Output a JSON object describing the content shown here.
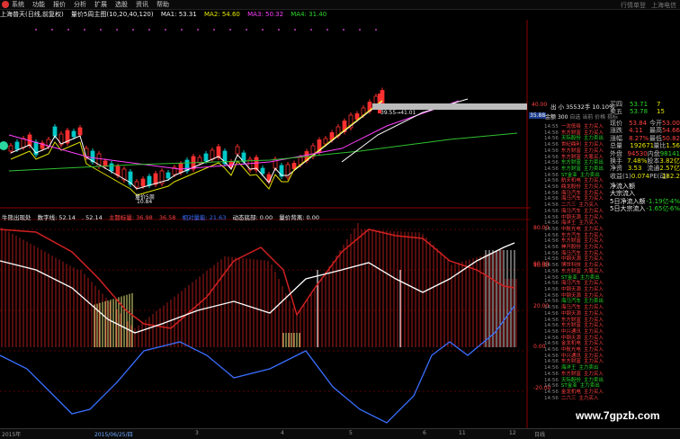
{
  "menu": {
    "items": [
      "系统",
      "功能",
      "报价",
      "分析",
      "扩展",
      "选股",
      "资讯",
      "帮助"
    ],
    "right": [
      "行情单登",
      "上海电信"
    ]
  },
  "chart_header": {
    "title": "上海普天(日线,前复权)",
    "indicator": "量价5周主图(10,20,40,120)",
    "ma1": "MA1: 53.31",
    "ma2": "MA2: 54.60",
    "ma3": "MA3: 50.32",
    "ma4": "MA4: 31.40"
  },
  "indicator_header": {
    "name": "牛熊出现处",
    "v1": "数字线: 52.14",
    "v2": ". 52.14",
    "v3": "主题标量: 36.98",
    "v4": "36.58",
    "v5": "相对量能: 21.63",
    "v6": "动态底部: 0.00",
    "v7": "量价背离: 0.00"
  },
  "price_labels": {
    "top": "40.00",
    "sell_tag": "出 小",
    "sell_vol": "35532手",
    "sell_pct": "10.10%",
    "price_line": "39.55→41.01",
    "left_price": "35.88",
    "low_label": "量价5周",
    "low_price": "10.84"
  },
  "axis_right": [
    "80.00",
    "60.00",
    "40.00",
    "20.00",
    "0.00",
    "-20.00"
  ],
  "quote": {
    "ask": {
      "label": "买四",
      "price": "53.71",
      "vol": "7"
    },
    "ask5": {
      "label": "卖五",
      "price": "53.78",
      "vol": "15"
    },
    "rows": [
      {
        "label": "现价",
        "value": "53.84",
        "l2": "今开",
        "v2": "53.00"
      },
      {
        "label": "涨跌",
        "value": "4.11",
        "l2": "最高",
        "v2": "54.66"
      },
      {
        "label": "涨幅",
        "value": "8.27%",
        "l2": "最低",
        "v2": "50.82"
      },
      {
        "label": "总量",
        "value": "192671",
        "l2": "量比",
        "v2": "1.56"
      },
      {
        "label": "外盘",
        "value": "94530",
        "l2": "内盘",
        "v2": "98141"
      },
      {
        "label": "换手",
        "value": "7.48%",
        "l2": "股本",
        "v2": "3.82亿"
      },
      {
        "label": "净资",
        "value": "3.53",
        "l2": "流通",
        "v2": "2.57亿"
      },
      {
        "label": "收益(1)",
        "value": "0.074",
        "l2": "PE(动)",
        "v2": "182.2"
      }
    ],
    "bid": {
      "label": "金额",
      "value": "300",
      "extra": "自选 当前 价格 指标"
    }
  },
  "funds": [
    {
      "label": "净流入额",
      "value": ""
    },
    {
      "label": "大宗流入",
      "value": ""
    },
    {
      "label": "5日净流入额",
      "value": "-1.19亿",
      "pct": "-4%"
    },
    {
      "label": "5日大宗流入",
      "value": "-1.65亿",
      "pct": "-6%"
    }
  ],
  "trades": [
    [
      "14:55",
      "一沈低吸",
      "主力买入"
    ],
    [
      "14:56",
      "东方财富",
      "主力买入"
    ],
    [
      "14:56",
      "天际股份",
      "主力卖出"
    ],
    [
      "14:56",
      "世纪鼎利",
      "主力买入"
    ],
    [
      "14:56",
      "东方财富",
      "主力买入"
    ],
    [
      "14:56",
      "东方财富",
      "大笔买入"
    ],
    [
      "14:56",
      "东方财富",
      "主力卖出"
    ],
    [
      "14:56",
      "东方财富",
      "主力卖出"
    ],
    [
      "14:56",
      "ST金亚",
      "主力卖出"
    ],
    [
      "14:56",
      "航天机电",
      "主力买入"
    ],
    [
      "14:56",
      "鼎龙股份",
      "主力买入"
    ],
    [
      "14:56",
      "海马汽车",
      "主力买入"
    ],
    [
      "14:56",
      "海马汽车",
      "主力买入"
    ],
    [
      "14:56",
      "二六三",
      "主力买入"
    ],
    [
      "14:56",
      "海马汽车",
      "主力买入"
    ],
    [
      "14:56",
      "中钢天源",
      "主力买入"
    ],
    [
      "14:56",
      "海洋王",
      "主力买入"
    ],
    [
      "14:56",
      "中航光电",
      "主力买入"
    ],
    [
      "14:56",
      "东方汽车",
      "主力买入"
    ],
    [
      "14:56",
      "东方财富",
      "主力买入"
    ],
    [
      "14:56",
      "神开股份",
      "主力买入"
    ],
    [
      "14:56",
      "海马汽车",
      "主力买入"
    ],
    [
      "14:56",
      "中钢天源",
      "主力买入"
    ],
    [
      "14:56",
      "博世科技",
      "主力买入"
    ],
    [
      "14:56",
      "东方财富",
      "大笔买入"
    ],
    [
      "14:56",
      "ST金亚",
      "主力卖出"
    ],
    [
      "14:56",
      "海马汽车",
      "主力买入"
    ],
    [
      "14:56",
      "中钢天源",
      "主力买入"
    ],
    [
      "14:56",
      "中钢天源",
      "主力买入"
    ],
    [
      "14:56",
      "海马汽车",
      "主力卖出"
    ],
    [
      "14:56",
      "海马汽车",
      "主力买入"
    ],
    [
      "14:56",
      "中钢天源",
      "主力买入"
    ],
    [
      "14:56",
      "东方财富",
      "主力买入"
    ],
    [
      "14:56",
      "东方财富",
      "主力买入"
    ],
    [
      "14:56",
      "中兴通讯",
      "主力买入"
    ],
    [
      "14:56",
      "中钢天源",
      "主力买入"
    ],
    [
      "14:56",
      "金龙机电",
      "主力买入"
    ],
    [
      "14:56",
      "中航光电",
      "主力买入"
    ],
    [
      "14:56",
      "中兴通讯",
      "主力买入"
    ],
    [
      "14:56",
      "东方财富",
      "主力买入"
    ],
    [
      "14:56",
      "海洋王",
      "主力卖出"
    ],
    [
      "14:56",
      "东方财富",
      "主力买入"
    ],
    [
      "14:56",
      "天际股份",
      "主力卖出"
    ],
    [
      "14:56",
      "ST金亚",
      "主力卖出"
    ],
    [
      "14:56",
      "金龙机电",
      "主力买入"
    ],
    [
      "14:56",
      "二六三",
      "主力买入"
    ]
  ],
  "status": {
    "left": "2015年",
    "mid": "2015/06/25/四",
    "t2": "3",
    "t3": "4",
    "t4": "5",
    "t5": "6",
    "t6": "11",
    "t7": "12",
    "right": "日线"
  },
  "watermark": "www.7gpzb.com",
  "colors": {
    "up": "#ff3030",
    "down": "#00c8c8",
    "ma1": "#ffffff",
    "ma2": "#e0e000",
    "ma3": "#ff40ff",
    "ma4": "#30c030"
  }
}
